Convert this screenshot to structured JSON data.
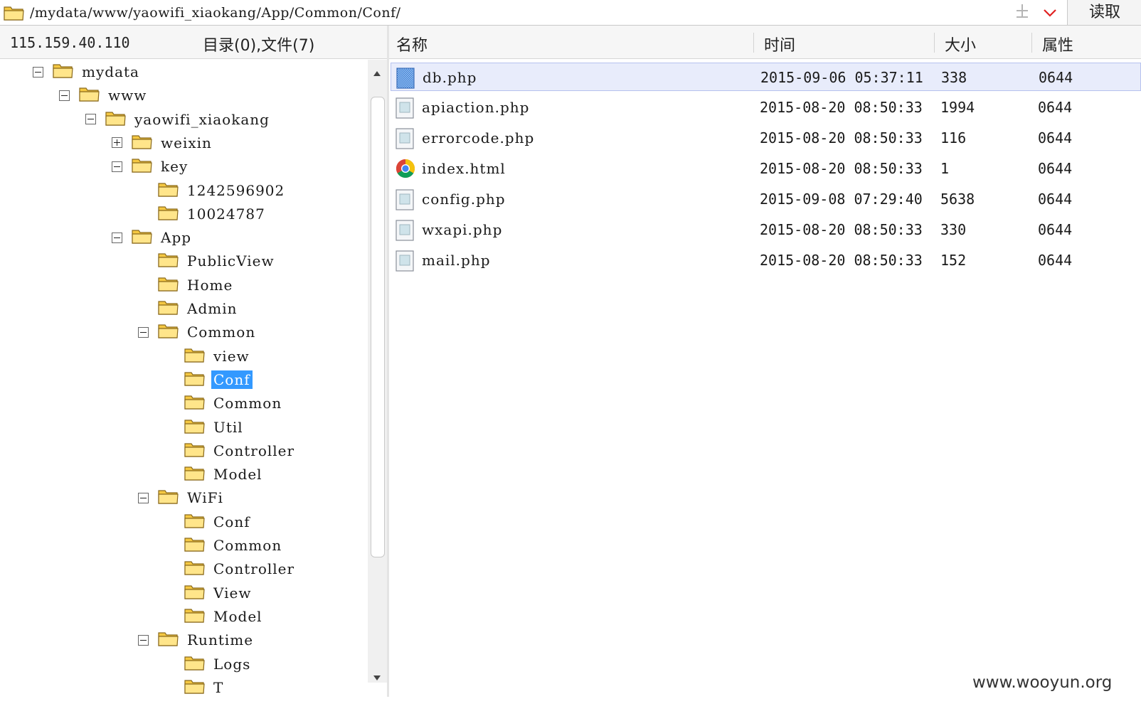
{
  "address_bar": {
    "path": "/mydata/www/yaowifi_xiaokang/App/Common/Conf/",
    "up_icon": "up-level-icon",
    "read_button": "读取"
  },
  "left_panel": {
    "server_ip": "115.159.40.110",
    "dir_count": "目录(0),文件(7)"
  },
  "tree": [
    {
      "label": "mydata",
      "depth": 0,
      "toggle": "minus"
    },
    {
      "label": "www",
      "depth": 1,
      "toggle": "minus"
    },
    {
      "label": "yaowifi_xiaokang",
      "depth": 2,
      "toggle": "minus"
    },
    {
      "label": "weixin",
      "depth": 3,
      "toggle": "plus"
    },
    {
      "label": "key",
      "depth": 3,
      "toggle": "minus"
    },
    {
      "label": "1242596902",
      "depth": 4,
      "toggle": "none"
    },
    {
      "label": "10024787",
      "depth": 4,
      "toggle": "none"
    },
    {
      "label": "App",
      "depth": 3,
      "toggle": "minus"
    },
    {
      "label": "PublicView",
      "depth": 4,
      "toggle": "none"
    },
    {
      "label": "Home",
      "depth": 4,
      "toggle": "none"
    },
    {
      "label": "Admin",
      "depth": 4,
      "toggle": "none"
    },
    {
      "label": "Common",
      "depth": 4,
      "toggle": "minus"
    },
    {
      "label": "view",
      "depth": 5,
      "toggle": "none"
    },
    {
      "label": "Conf",
      "depth": 5,
      "toggle": "none",
      "selected": true
    },
    {
      "label": "Common",
      "depth": 5,
      "toggle": "none"
    },
    {
      "label": "Util",
      "depth": 5,
      "toggle": "none"
    },
    {
      "label": "Controller",
      "depth": 5,
      "toggle": "none"
    },
    {
      "label": "Model",
      "depth": 5,
      "toggle": "none"
    },
    {
      "label": "WiFi",
      "depth": 4,
      "toggle": "minus"
    },
    {
      "label": "Conf",
      "depth": 5,
      "toggle": "none"
    },
    {
      "label": "Common",
      "depth": 5,
      "toggle": "none"
    },
    {
      "label": "Controller",
      "depth": 5,
      "toggle": "none"
    },
    {
      "label": "View",
      "depth": 5,
      "toggle": "none"
    },
    {
      "label": "Model",
      "depth": 5,
      "toggle": "none"
    },
    {
      "label": "Runtime",
      "depth": 4,
      "toggle": "minus"
    },
    {
      "label": "Logs",
      "depth": 5,
      "toggle": "none"
    },
    {
      "label": "T",
      "depth": 5,
      "toggle": "none"
    }
  ],
  "file_columns": {
    "name": "名称",
    "time": "时间",
    "size": "大小",
    "attr": "属性"
  },
  "files": [
    {
      "name": "db.php",
      "time": "2015-09-06 05:37:11",
      "size": "338",
      "attr": "0644",
      "icon": "file-icon",
      "selected": true
    },
    {
      "name": "apiaction.php",
      "time": "2015-08-20 08:50:33",
      "size": "1994",
      "attr": "0644",
      "icon": "file-icon"
    },
    {
      "name": "errorcode.php",
      "time": "2015-08-20 08:50:33",
      "size": "116",
      "attr": "0644",
      "icon": "file-icon"
    },
    {
      "name": "index.html",
      "time": "2015-08-20 08:50:33",
      "size": "1",
      "attr": "0644",
      "icon": "chrome-icon"
    },
    {
      "name": "config.php",
      "time": "2015-09-08 07:29:40",
      "size": "5638",
      "attr": "0644",
      "icon": "file-icon"
    },
    {
      "name": "wxapi.php",
      "time": "2015-08-20 08:50:33",
      "size": "330",
      "attr": "0644",
      "icon": "file-icon"
    },
    {
      "name": "mail.php",
      "time": "2015-08-20 08:50:33",
      "size": "152",
      "attr": "0644",
      "icon": "file-icon"
    }
  ],
  "watermark": "www.wooyun.org",
  "colors": {
    "selection": "#3399ff",
    "row_selected": "#e8ecfb",
    "folder": "#f5c842"
  }
}
